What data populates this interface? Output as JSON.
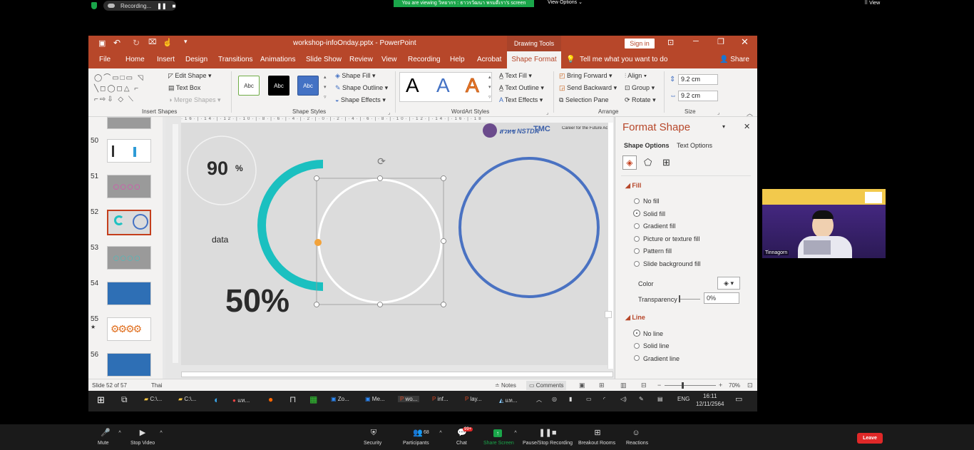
{
  "zoom": {
    "recording_label": "Recording...",
    "viewing_banner": "You are viewing วิทยากร : ธาวรวัฒนา พรมดีเรา's screen",
    "view_options": "View Options",
    "view": "View",
    "participant_name": "Tinnagorn",
    "bottom": {
      "mute": "Mute",
      "stop_video": "Stop Video",
      "security": "Security",
      "participants": "Participants",
      "participants_count": "68",
      "chat": "Chat",
      "chat_badge": "99+",
      "share_screen": "Share Screen",
      "pause_recording": "Pause/Stop Recording",
      "breakout": "Breakout Rooms",
      "reactions": "Reactions",
      "leave": "Leave"
    }
  },
  "ppt": {
    "filename": "workshop-infoOnday.pptx  -  PowerPoint",
    "drawing_tools": "Drawing Tools",
    "sign_in": "Sign in",
    "menu": [
      "File",
      "Home",
      "Insert",
      "Design",
      "Transitions",
      "Animations",
      "Slide Show",
      "Review",
      "View",
      "Recording",
      "Help",
      "Acrobat",
      "Shape Format"
    ],
    "tell_me": "Tell me what you want to do",
    "share": "Share",
    "ribbon": {
      "edit_shape": "Edit Shape",
      "text_box": "Text Box",
      "merge_shapes": "Merge Shapes",
      "insert_shapes": "Insert Shapes",
      "abc": "Abc",
      "shape_fill": "Shape Fill",
      "shape_outline": "Shape Outline",
      "shape_effects": "Shape Effects",
      "shape_styles": "Shape Styles",
      "wordart_a": "A",
      "text_fill": "Text Fill",
      "text_outline": "Text Outline",
      "text_effects": "Text Effects",
      "wordart_styles": "WordArt Styles",
      "bring_forward": "Bring Forward",
      "send_backward": "Send Backward",
      "selection_pane": "Selection Pane",
      "align": "Align",
      "group": "Group",
      "rotate": "Rotate",
      "arrange": "Arrange",
      "height": "9.2 cm",
      "width": "9.2 cm",
      "size": "Size"
    },
    "thumbs": [
      {
        "num": "50",
        "star": ""
      },
      {
        "num": "51",
        "star": ""
      },
      {
        "num": "52",
        "star": ""
      },
      {
        "num": "53",
        "star": ""
      },
      {
        "num": "54",
        "star": ""
      },
      {
        "num": "55",
        "star": "★"
      },
      {
        "num": "56",
        "star": ""
      }
    ],
    "slide": {
      "pct90": "90",
      "pct_sign": "%",
      "data_label": "data",
      "pct50": "50%",
      "logo_nstda": "สวทช NSTDA",
      "logo_tmc": "TMC",
      "logo_caption": "Career for the Future Ac"
    },
    "format_pane": {
      "title": "Format Shape",
      "shape_options": "Shape Options",
      "text_options": "Text Options",
      "fill": "Fill",
      "fill_options": [
        "No fill",
        "Solid fill",
        "Gradient fill",
        "Picture or texture fill",
        "Pattern fill",
        "Slide background fill"
      ],
      "color": "Color",
      "transparency": "Transparency",
      "transparency_value": "0%",
      "line": "Line",
      "line_options": [
        "No line",
        "Solid line",
        "Gradient line"
      ]
    },
    "status": {
      "slide_of": "Slide 52 of 57",
      "language": "Thai",
      "notes": "Notes",
      "comments": "Comments",
      "zoom": "70%"
    },
    "taskbar": {
      "items": [
        "C:\\...",
        "C:\\...",
        "แท...",
        "Zo...",
        "Me...",
        "wo...",
        "inf...",
        "lay...",
        "แท..."
      ],
      "lang": "ENG",
      "time": "16:11",
      "date": "12/11/2564"
    }
  }
}
